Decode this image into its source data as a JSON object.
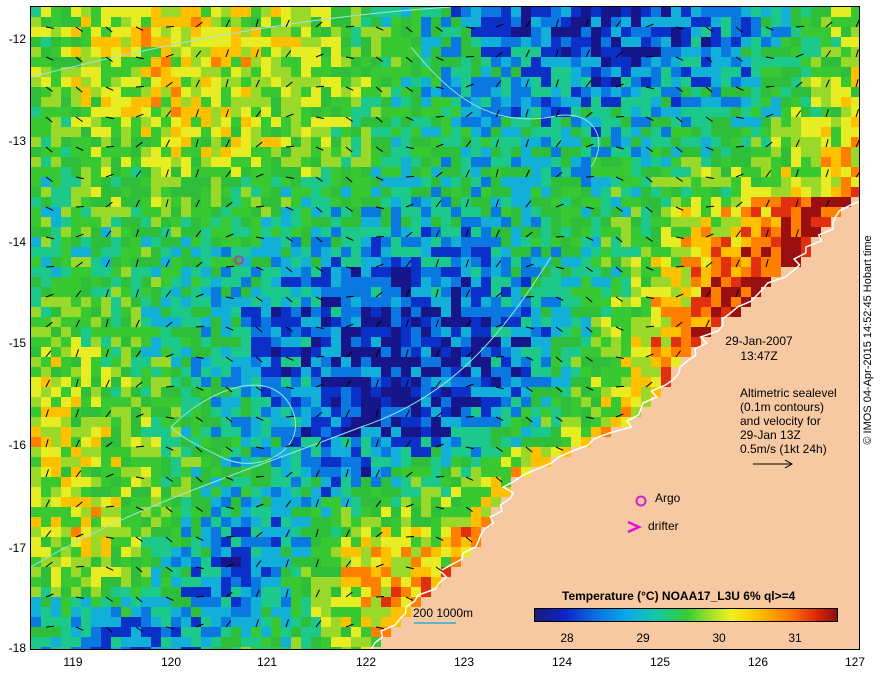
{
  "map": {
    "y_ticks": [
      "-12",
      "-13",
      "-14",
      "-15",
      "-16",
      "-17",
      "-18"
    ],
    "x_ticks": [
      "119",
      "120",
      "121",
      "122",
      "123",
      "124",
      "125",
      "126",
      "127"
    ],
    "date": "29-Jan-2007",
    "time": "13:47Z",
    "altimetry_lines": [
      "Altimetric sealevel",
      "(0.1m contours)",
      "and velocity for",
      "29-Jan 13Z",
      "0.5m/s (1kt 24h)"
    ],
    "argo_label": "Argo",
    "drifter_label": "drifter",
    "legend_title": "Temperature (°C) NOAA17_L3U 6% ql>=4",
    "colorbar_ticks": [
      "28",
      "29",
      "30",
      "31"
    ],
    "scale_label": "200  1000m",
    "credit": "© IMOS 04-Apr-2015 14:52:45 Hobart time",
    "colors": {
      "land": "#f7c9a2",
      "contour": "#9ae6e6",
      "argo": "#d020d0",
      "drifter": "#e010e0"
    }
  }
}
